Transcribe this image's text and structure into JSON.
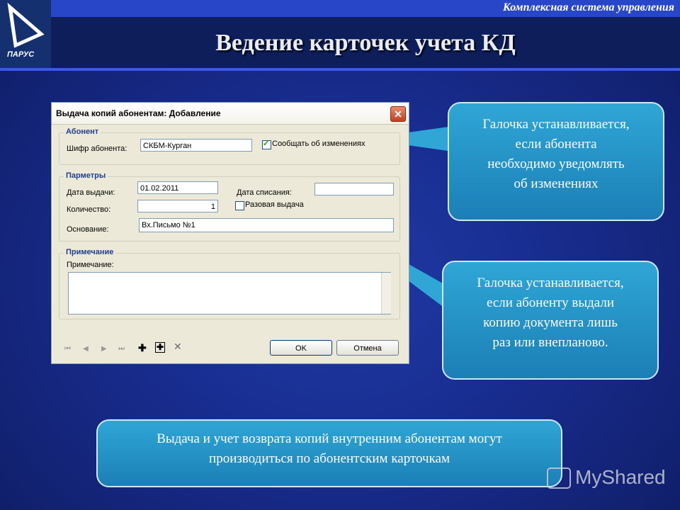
{
  "header": {
    "brand": "Комплексная система управления",
    "title": "Ведение карточек учета КД",
    "logo_text": "ПАРУС"
  },
  "dialog": {
    "title": "Выдача копий абонентам: Добавление",
    "close_icon": "close-icon",
    "group_subscriber": {
      "legend": "Абонент",
      "code_label": "Шифр абонента:",
      "code_value": "СКБМ-Курган",
      "notify_label": "Сообщать об изменениях",
      "notify_checked": true
    },
    "group_params": {
      "legend": "Парметры",
      "issue_date_label": "Дата выдачи:",
      "issue_date_value": "01.02.2011",
      "writeoff_date_label": "Дата списания:",
      "writeoff_date_value": "",
      "quantity_label": "Количество:",
      "quantity_value": "1",
      "one_time_label": "Разовая выдача",
      "one_time_checked": false,
      "basis_label": "Основание:",
      "basis_value": "Вх.Письмо №1"
    },
    "group_note": {
      "legend": "Примечание",
      "note_label": "Примечание:",
      "note_value": ""
    },
    "ok_label": "OK",
    "cancel_label": "Отмена"
  },
  "callouts": {
    "top": [
      "Галочка устанавливается,",
      "если абонента",
      "необходимо уведомлять",
      "об изменениях"
    ],
    "middle": [
      "Галочка устанавливается,",
      "если абоненту выдали",
      "копию документа лишь",
      "раз или внепланово."
    ],
    "bottom": [
      "Выдача и учет возврата копий внутренним абонентам могут",
      "производиться по абонентским карточкам"
    ]
  },
  "watermark": "MyShared",
  "colors": {
    "background": "#1a2a8c",
    "callout": "#2596cc",
    "title_band": "#0d1e5a"
  }
}
